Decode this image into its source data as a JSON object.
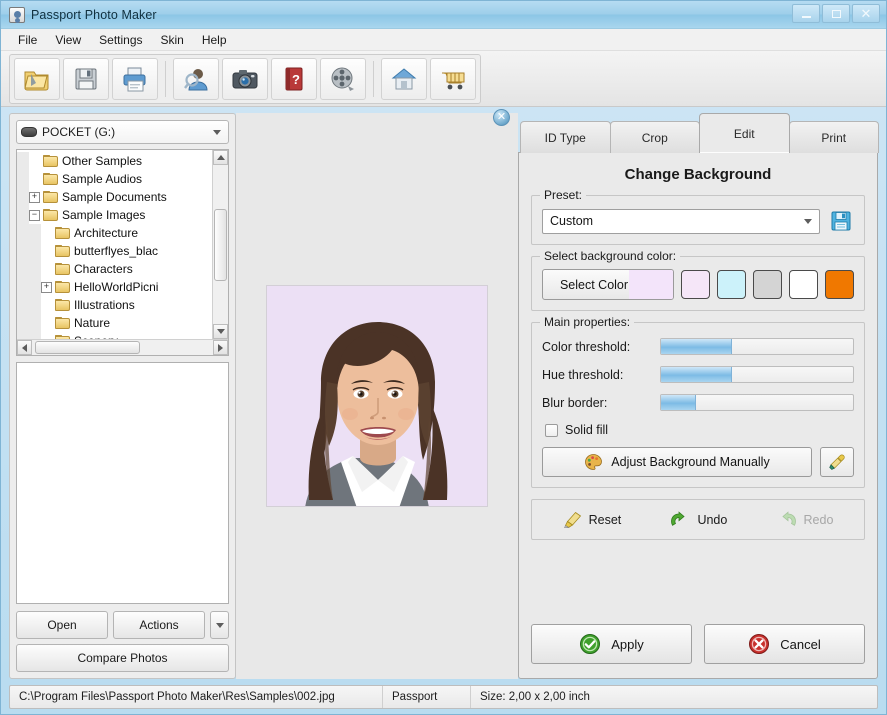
{
  "window": {
    "title": "Passport Photo Maker",
    "icon": "app-icon",
    "controls": {
      "minimize": "minimize",
      "maximize": "maximize",
      "close": "close"
    }
  },
  "menu": {
    "items": [
      "File",
      "View",
      "Settings",
      "Skin",
      "Help"
    ]
  },
  "toolbar": {
    "buttons": [
      {
        "name": "open-photo-button",
        "icon": "open-folder-icon"
      },
      {
        "name": "save-button",
        "icon": "floppy-disk-icon"
      },
      {
        "name": "print-button",
        "icon": "printer-icon"
      },
      {
        "name": "person-preview-button",
        "icon": "person-search-icon"
      },
      {
        "name": "camera-button",
        "icon": "camera-icon"
      },
      {
        "name": "help-button",
        "icon": "help-book-icon"
      },
      {
        "name": "video-button",
        "icon": "film-reel-icon"
      },
      {
        "name": "home-button",
        "icon": "house-icon"
      },
      {
        "name": "buy-button",
        "icon": "shopping-cart-icon"
      }
    ],
    "close_icon": "close-circle-icon"
  },
  "explorer": {
    "drive": {
      "label": "POCKET (G:)",
      "icon": "drive-icon"
    },
    "tree": [
      {
        "label": "Other Samples",
        "depth": 2,
        "expander": "none"
      },
      {
        "label": "Sample Audios",
        "depth": 2,
        "expander": "none"
      },
      {
        "label": "Sample Documents",
        "depth": 2,
        "expander": "plus"
      },
      {
        "label": "Sample Images",
        "depth": 2,
        "expander": "minus"
      },
      {
        "label": "Architecture",
        "depth": 3,
        "expander": "none"
      },
      {
        "label": "butterflyes_blac",
        "depth": 3,
        "expander": "none"
      },
      {
        "label": "Characters",
        "depth": 3,
        "expander": "none"
      },
      {
        "label": "HelloWorldPicni",
        "depth": 3,
        "expander": "plus"
      },
      {
        "label": "Illustrations",
        "depth": 3,
        "expander": "none"
      },
      {
        "label": "Nature",
        "depth": 3,
        "expander": "none"
      },
      {
        "label": "Scenery",
        "depth": 3,
        "expander": "none"
      }
    ],
    "buttons": {
      "open": "Open",
      "actions": "Actions",
      "compare": "Compare Photos"
    }
  },
  "preview": {
    "background_color": "#ece0f5"
  },
  "tabs": [
    {
      "label": "ID Type",
      "active": false
    },
    {
      "label": "Crop",
      "active": false
    },
    {
      "label": "Edit",
      "active": true
    },
    {
      "label": "Print",
      "active": false
    }
  ],
  "edit_panel": {
    "title": "Change Background",
    "preset": {
      "group_label": "Preset:",
      "value": "Custom",
      "save_icon": "floppy-disk-icon"
    },
    "background_color": {
      "group_label": "Select background color:",
      "select_button_label": "Select Color",
      "current_color": "#f3e4fa",
      "swatches": [
        "#f5e6f8",
        "#ccf2fa",
        "#d4d4d4",
        "#ffffff",
        "#f07800"
      ]
    },
    "main_properties": {
      "group_label": "Main properties:",
      "sliders": [
        {
          "label": "Color threshold:",
          "percent": 37
        },
        {
          "label": "Hue threshold:",
          "percent": 37
        },
        {
          "label": "Blur border:",
          "percent": 18
        }
      ],
      "solid_fill": {
        "label": "Solid fill",
        "checked": false
      },
      "adjust_button": {
        "label": "Adjust Background Manually",
        "icon": "palette-icon"
      },
      "eyedropper": {
        "icon": "eyedropper-icon"
      }
    },
    "history": [
      {
        "label": "Reset",
        "icon": "brush-icon",
        "disabled": false
      },
      {
        "label": "Undo",
        "icon": "undo-arrow-icon",
        "disabled": false
      },
      {
        "label": "Redo",
        "icon": "redo-arrow-icon",
        "disabled": true
      }
    ],
    "apply_button": {
      "label": "Apply",
      "icon": "green-check-icon"
    },
    "cancel_button": {
      "label": "Cancel",
      "icon": "red-x-icon"
    }
  },
  "status_bar": {
    "path": "C:\\Program Files\\Passport Photo Maker\\Res\\Samples\\002.jpg",
    "doc_type": "Passport",
    "size": "Size: 2,00 x 2,00 inch"
  }
}
